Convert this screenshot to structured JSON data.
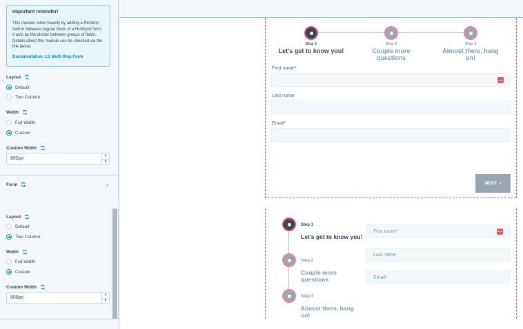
{
  "reminder": {
    "title": "Important reminder!",
    "body": "This module relies heavily by adding a Richtext field in between regular fields of a HubSpot form. It acts as the divider between groups of fields. Details about this module can be checked via the link below.",
    "link": "Documentation: LS Multi-Step Form"
  },
  "top_panel": {
    "layout_label": "Layout",
    "layout_options": [
      "Default",
      "Two Column"
    ],
    "layout_selected": "Default",
    "width_label": "Width",
    "width_options": [
      "Full Width",
      "Custom"
    ],
    "width_selected": "Custom",
    "custom_width_label": "Custom Width",
    "custom_width_value": "800px",
    "form_label": "Form"
  },
  "bottom_panel": {
    "layout_label": "Layout",
    "layout_options": [
      "Default",
      "Two Column"
    ],
    "layout_selected": "Two Column",
    "width_label": "Width",
    "width_options": [
      "Full Width",
      "Custom"
    ],
    "width_selected": "Custom",
    "custom_width_label": "Custom Width",
    "custom_width_value": "800px"
  },
  "steps": [
    {
      "small": "Step 1",
      "title": "Let's get to know you!",
      "active": true
    },
    {
      "small": "Step 2",
      "title": "Couple more questions",
      "active": false
    },
    {
      "small": "Step 3",
      "title": "Almost there, hang on!",
      "active": false
    }
  ],
  "form_default": {
    "fields": [
      {
        "label": "First name*"
      },
      {
        "label": "Last name"
      },
      {
        "label": "Email*"
      }
    ],
    "next_label": "NEXT"
  },
  "form_two_column": {
    "fields": [
      {
        "placeholder": "First name*"
      },
      {
        "placeholder": "Last name"
      },
      {
        "placeholder": "Email*"
      }
    ]
  },
  "colors": {
    "accent": "#0091ae",
    "step_ring": "#e35865",
    "button": "#99a6b2"
  }
}
